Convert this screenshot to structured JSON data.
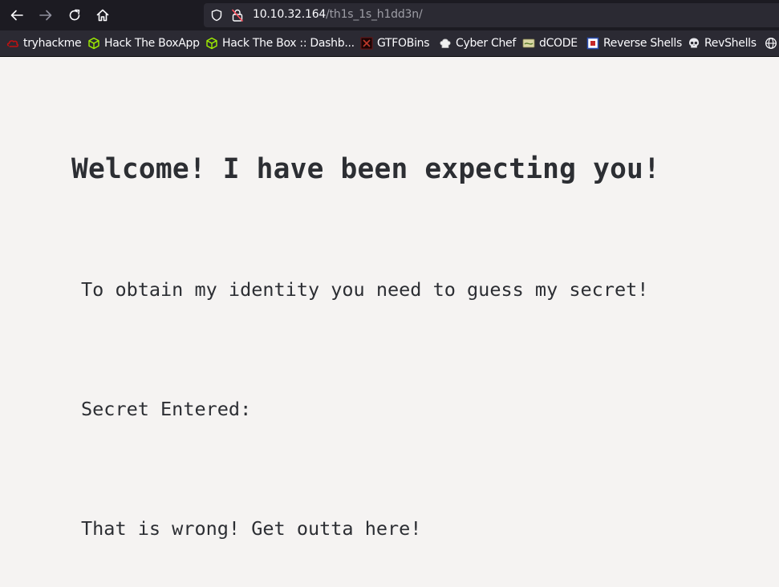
{
  "browser": {
    "url_host": "10.10.32.164",
    "url_path": "/th1s_1s_h1dd3n/"
  },
  "bookmarks": [
    {
      "label": "tryhackme",
      "icon": "tryhackme-icon"
    },
    {
      "label": "Hack The BoxApp",
      "icon": "hackthebox-icon"
    },
    {
      "label": "Hack The Box :: Dashb...",
      "icon": "hackthebox-icon"
    },
    {
      "label": "GTFOBins",
      "icon": "gtfobins-icon"
    },
    {
      "label": "Cyber Chef",
      "icon": "chef-hat-icon"
    },
    {
      "label": "dCODE",
      "icon": "dcode-icon"
    },
    {
      "label": "Reverse Shells",
      "icon": "reverse-shells-icon"
    },
    {
      "label": "RevShells",
      "icon": "skull-icon"
    }
  ],
  "page": {
    "heading": "Welcome! I have been expecting you!",
    "instruction": "To obtain my identity you need to guess my secret!",
    "secret_entered": "Secret Entered:",
    "result": "That is wrong! Get outta here!"
  },
  "colors": {
    "toolbar_bg": "#1c1b22",
    "urlbar_bg": "#2b2a33",
    "page_bg": "#f5f3f2",
    "text": "#2c2e33"
  }
}
